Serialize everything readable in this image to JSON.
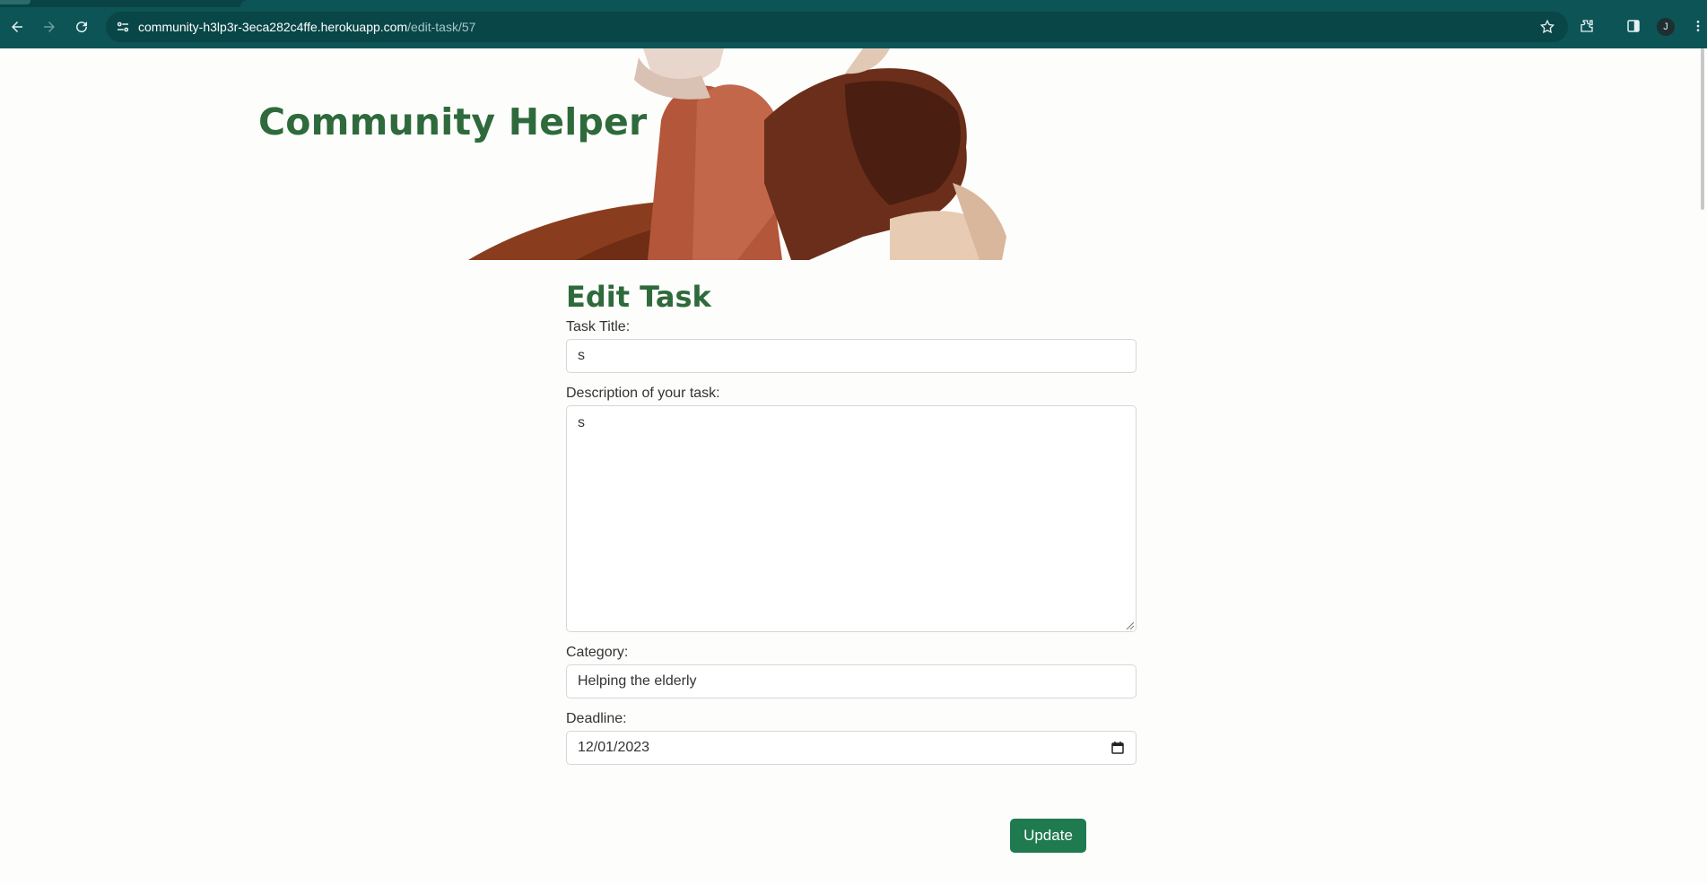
{
  "browser": {
    "url_host": "community-h3lp3r-3eca282c4ffe.herokuapp.com",
    "url_path": "/edit-task/57",
    "profile_initial": "J"
  },
  "site": {
    "brand": "Community Helper"
  },
  "form": {
    "title": "Edit Task",
    "task_title_label": "Task Title:",
    "task_title_value": "s",
    "description_label": "Description of your task:",
    "description_value": "s",
    "category_label": "Category:",
    "category_value": "Helping the elderly",
    "deadline_label": "Deadline:",
    "deadline_value": "12/01/2023",
    "submit_label": "Update"
  },
  "colors": {
    "chrome": "#0d5457",
    "brand_green": "#2e6a3b",
    "button_green": "#1f7a4f"
  },
  "icons": [
    "back-arrow-icon",
    "forward-arrow-icon",
    "reload-icon",
    "site-info-icon",
    "bookmark-star-icon",
    "extensions-icon",
    "side-panel-icon",
    "menu-kebab-icon",
    "calendar-icon"
  ]
}
